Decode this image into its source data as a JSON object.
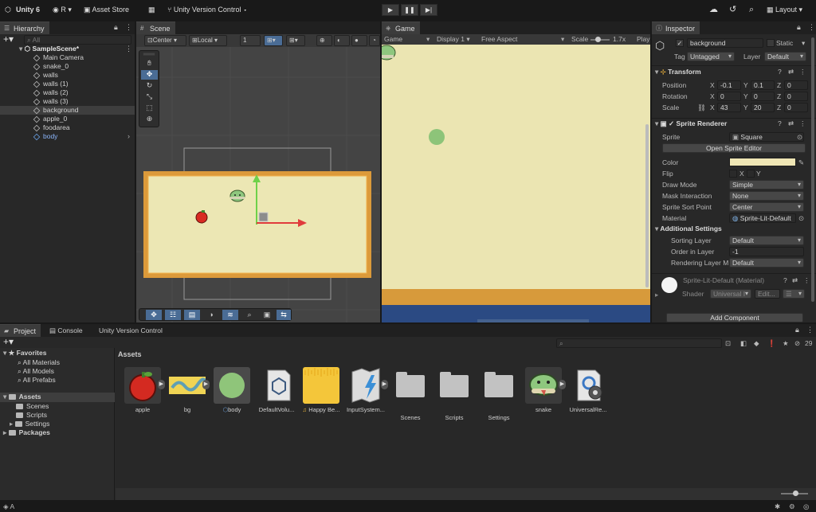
{
  "topbar": {
    "unity_version": "Unity 6",
    "account": "R",
    "asset_store": "Asset Store",
    "version_control": "Unity Version Control",
    "layout": "Layout"
  },
  "hierarchy": {
    "tab": "Hierarchy",
    "search_placeholder": "All",
    "scene": "SampleScene*",
    "items": [
      "Main Camera",
      "snake_0",
      "walls",
      "walls (1)",
      "walls (2)",
      "walls (3)",
      "background",
      "apple_0",
      "foodarea",
      "body"
    ]
  },
  "scene": {
    "tab": "Scene",
    "pivot": "Center",
    "space": "Local",
    "grid_value": "1"
  },
  "game": {
    "tab": "Game",
    "display_mode": "Game",
    "display": "Display 1",
    "aspect": "Free Aspect",
    "scale_label": "Scale",
    "scale_value": "1.7x",
    "play_label": "Play"
  },
  "inspector": {
    "tab": "Inspector",
    "object_name": "background",
    "static_label": "Static",
    "tag_label": "Tag",
    "tag_value": "Untagged",
    "layer_label": "Layer",
    "layer_value": "Default",
    "transform": {
      "title": "Transform",
      "position": {
        "label": "Position",
        "x": "-0.1",
        "y": "0.1",
        "z": "0"
      },
      "rotation": {
        "label": "Rotation",
        "x": "0",
        "y": "0",
        "z": "0"
      },
      "scale": {
        "label": "Scale",
        "x": "43",
        "y": "20",
        "z": "0"
      }
    },
    "sprite_renderer": {
      "title": "Sprite Renderer",
      "sprite_label": "Sprite",
      "sprite_value": "Square",
      "open_editor": "Open Sprite Editor",
      "color_label": "Color",
      "color_value": "#efe6b5",
      "flip_label": "Flip",
      "flip_x": "X",
      "flip_y": "Y",
      "draw_mode_label": "Draw Mode",
      "draw_mode_value": "Simple",
      "mask_label": "Mask Interaction",
      "mask_value": "None",
      "sort_point_label": "Sprite Sort Point",
      "sort_point_value": "Center",
      "material_label": "Material",
      "material_value": "Sprite-Lit-Default",
      "additional": "Additional Settings",
      "sorting_layer_label": "Sorting Layer",
      "sorting_layer_value": "Default",
      "order_label": "Order in Layer",
      "order_value": "-1",
      "rendering_layer_label": "Rendering Layer M",
      "rendering_layer_value": "Default"
    },
    "material": {
      "name": "Sprite-Lit-Default (Material)",
      "shader_label": "Shader",
      "shader_value": "Universal I",
      "edit_label": "Edit..."
    },
    "add_component": "Add Component"
  },
  "bottom": {
    "tabs": [
      "Project",
      "Console",
      "Unity Version Control"
    ],
    "hidden_count": "29",
    "favorites": {
      "label": "Favorites",
      "items": [
        "All Materials",
        "All Models",
        "All Prefabs"
      ]
    },
    "assets_tree": {
      "label": "Assets",
      "items": [
        "Scenes",
        "Scripts",
        "Settings"
      ]
    },
    "packages": "Packages",
    "breadcrumb": "Assets",
    "assets": [
      "apple",
      "bg",
      "body",
      "DefaultVolu...",
      "Happy Be...",
      "InputSystem...",
      "Scenes",
      "Scripts",
      "Settings",
      "snake",
      "UniversalRe..."
    ]
  },
  "statusbar": {
    "text": "A"
  },
  "colors": {
    "game_bg": "#ebe5b2",
    "orange_wall": "#d79a3b",
    "blue_wall": "#2b4a83",
    "green_dot": "#8dc479",
    "accent": "#3d6ea6"
  }
}
